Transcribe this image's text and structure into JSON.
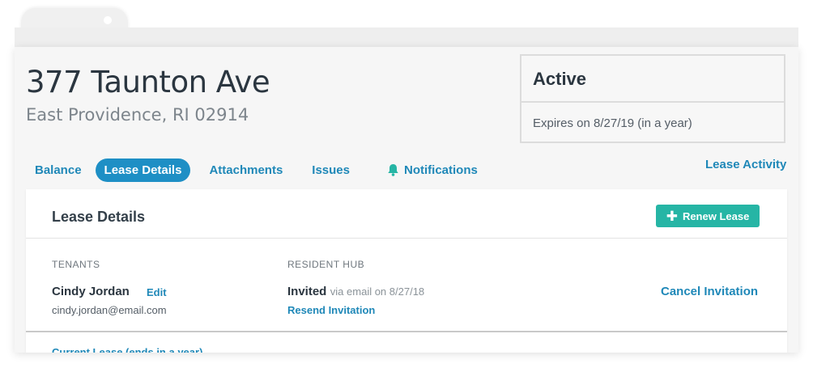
{
  "property": {
    "address_line1": "377 Taunton Ave",
    "address_line2": "East Providence, RI 02914"
  },
  "status": {
    "title": "Active",
    "expires": "Expires on 8/27/19 (in a year)"
  },
  "tabs": [
    {
      "label": "Balance",
      "active": false
    },
    {
      "label": "Lease Details",
      "active": true
    },
    {
      "label": "Attachments",
      "active": false
    },
    {
      "label": "Issues",
      "active": false
    },
    {
      "label": "Notifications",
      "active": false,
      "icon": "bell-icon"
    }
  ],
  "lease_activity_label": "Lease Activity",
  "lease_details": {
    "title": "Lease Details",
    "renew_label": "Renew Lease",
    "tenants_label": "TENANTS",
    "resident_hub_label": "RESIDENT HUB",
    "tenant": {
      "name": "Cindy Jordan",
      "edit_label": "Edit",
      "email": "cindy.jordan@email.com"
    },
    "invitation": {
      "status": "Invited",
      "detail": "via email on 8/27/18",
      "resend_label": "Resend Invitation",
      "cancel_label": "Cancel Invitation"
    },
    "current_lease_label": "Current Lease (ends in a year)"
  },
  "colors": {
    "accent": "#1e8fc5",
    "link": "#1f88b8",
    "renew_button": "#26b5a5",
    "heading": "#2b3640"
  }
}
